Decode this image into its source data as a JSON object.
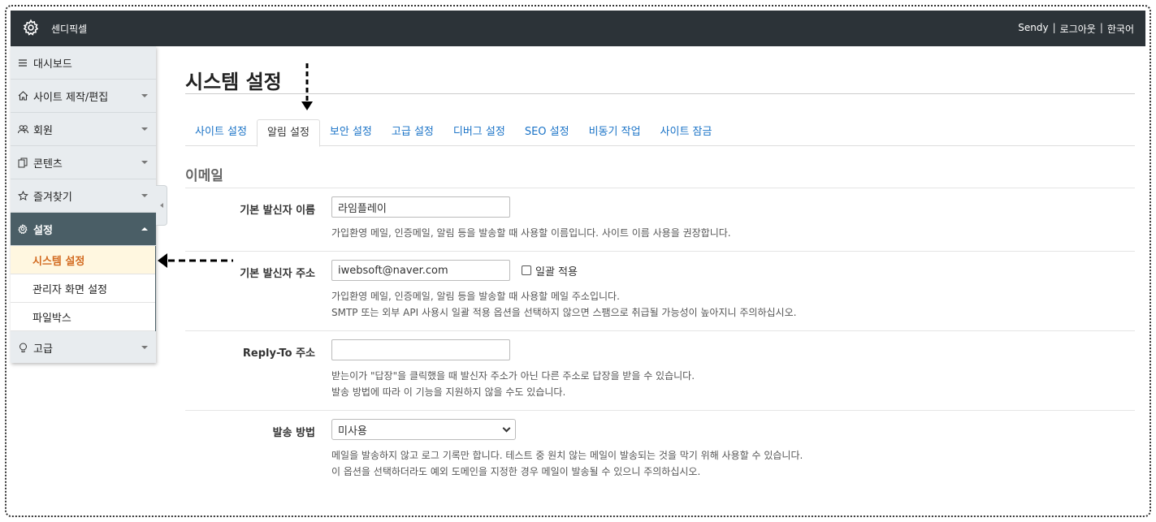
{
  "topbar": {
    "brand": "센디픽셀",
    "brand_icon": "gear-icon",
    "user": "Sendy",
    "sep1": "|",
    "logout": "로그아웃",
    "sep2": "|",
    "language": "한국어"
  },
  "sidebar": {
    "items": [
      {
        "label": "대시보드",
        "icon": "menu-icon"
      },
      {
        "label": "사이트 제작/편집",
        "icon": "home-icon"
      },
      {
        "label": "회원",
        "icon": "users-icon"
      },
      {
        "label": "콘텐츠",
        "icon": "copy-icon"
      },
      {
        "label": "즐겨찾기",
        "icon": "star-icon"
      },
      {
        "label": "설정",
        "icon": "gear-icon"
      },
      {
        "label": "고급",
        "icon": "bulb-icon"
      }
    ],
    "submenu": [
      "시스템 설정",
      "관리자 화면 설정",
      "파일박스"
    ]
  },
  "main": {
    "title": "시스템 설정",
    "tabs": [
      "사이트 설정",
      "알림 설정",
      "보안 설정",
      "고급 설정",
      "디버그 설정",
      "SEO 설정",
      "비동기 작업",
      "사이트 잠금"
    ],
    "section": "이메일",
    "rows": {
      "sender_name": {
        "label": "기본 발신자 이름",
        "value": "라임플레이",
        "help": "가입환영 메일, 인증메일, 알림 등을 발송할 때 사용할 이름입니다. 사이트 이름 사용을 권장합니다."
      },
      "sender_address": {
        "label": "기본 발신자 주소",
        "value": "iwebsoft@naver.com",
        "checkbox": "일괄 적용",
        "help1": "가입환영 메일, 인증메일, 알림 등을 발송할 때 사용할 메일 주소입니다.",
        "help2": "SMTP 또는 외부 API 사용시 일괄 적용 옵션을 선택하지 않으면 스팸으로 취급될 가능성이 높아지니 주의하십시오."
      },
      "reply_to": {
        "label": "Reply-To 주소",
        "value": "",
        "help1": "받는이가 \"답장\"을 클릭했을 때 발신자 주소가 아닌 다른 주소로 답장을 받을 수 있습니다.",
        "help2": "발송 방법에 따라 이 기능을 지원하지 않을 수도 있습니다."
      },
      "send_method": {
        "label": "발송 방법",
        "value": "미사용",
        "help1": "메일을 발송하지 않고 로그 기록만 합니다. 테스트 중 원치 않는 메일이 발송되는 것을 막기 위해 사용할 수 있습니다.",
        "help2": "이 옵션을 선택하더라도 예외 도메인을 지정한 경우 메일이 발송될 수 있으니 주의하십시오."
      }
    }
  }
}
